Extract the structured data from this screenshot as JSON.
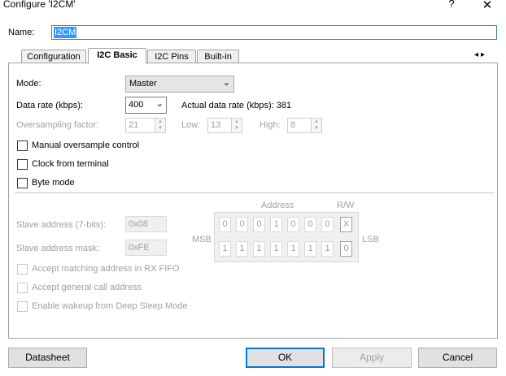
{
  "window": {
    "title": "Configure 'I2CM'",
    "help": "?",
    "close": "✕"
  },
  "name_field": {
    "label": "Name:",
    "value": "I2CM"
  },
  "tabs": [
    {
      "label": "Configuration",
      "active": false
    },
    {
      "label": "I2C Basic",
      "active": true
    },
    {
      "label": "I2C Pins",
      "active": false
    },
    {
      "label": "Built-in",
      "active": false
    }
  ],
  "tab_scroll": {
    "left": "◂",
    "right": "▸"
  },
  "basic": {
    "mode": {
      "label": "Mode:",
      "value": "Master"
    },
    "data_rate": {
      "label": "Data rate (kbps):",
      "value": "400",
      "actual_label": "Actual data rate (kbps): 381"
    },
    "oversampling": {
      "label": "Oversampling factor:",
      "value": "21",
      "low_label": "Low:",
      "low_value": "13",
      "high_label": "High:",
      "high_value": "8"
    },
    "checks": [
      {
        "label": "Manual oversample control",
        "checked": false
      },
      {
        "label": "Clock from terminal",
        "checked": false
      },
      {
        "label": "Byte mode",
        "checked": false
      }
    ]
  },
  "slave": {
    "address": {
      "label": "Slave address (7-bits):",
      "value": "0x08"
    },
    "mask": {
      "label": "Slave address mask:",
      "value": "0xFE"
    },
    "grid": {
      "address_header": "Address",
      "rw_header": "R/W",
      "msb": "MSB",
      "lsb": "LSB",
      "row1": [
        "0",
        "0",
        "0",
        "1",
        "0",
        "0",
        "0",
        "X"
      ],
      "row2": [
        "1",
        "1",
        "1",
        "1",
        "1",
        "1",
        "1",
        "0"
      ]
    },
    "checks": [
      {
        "label": "Accept matching address in RX FIFO",
        "checked": false
      },
      {
        "label": "Accept general call address",
        "checked": false
      },
      {
        "label": "Enable wakeup from Deep Sleep Mode",
        "checked": false
      }
    ]
  },
  "buttons": {
    "datasheet": "Datasheet",
    "ok": "OK",
    "apply": "Apply",
    "cancel": "Cancel"
  }
}
